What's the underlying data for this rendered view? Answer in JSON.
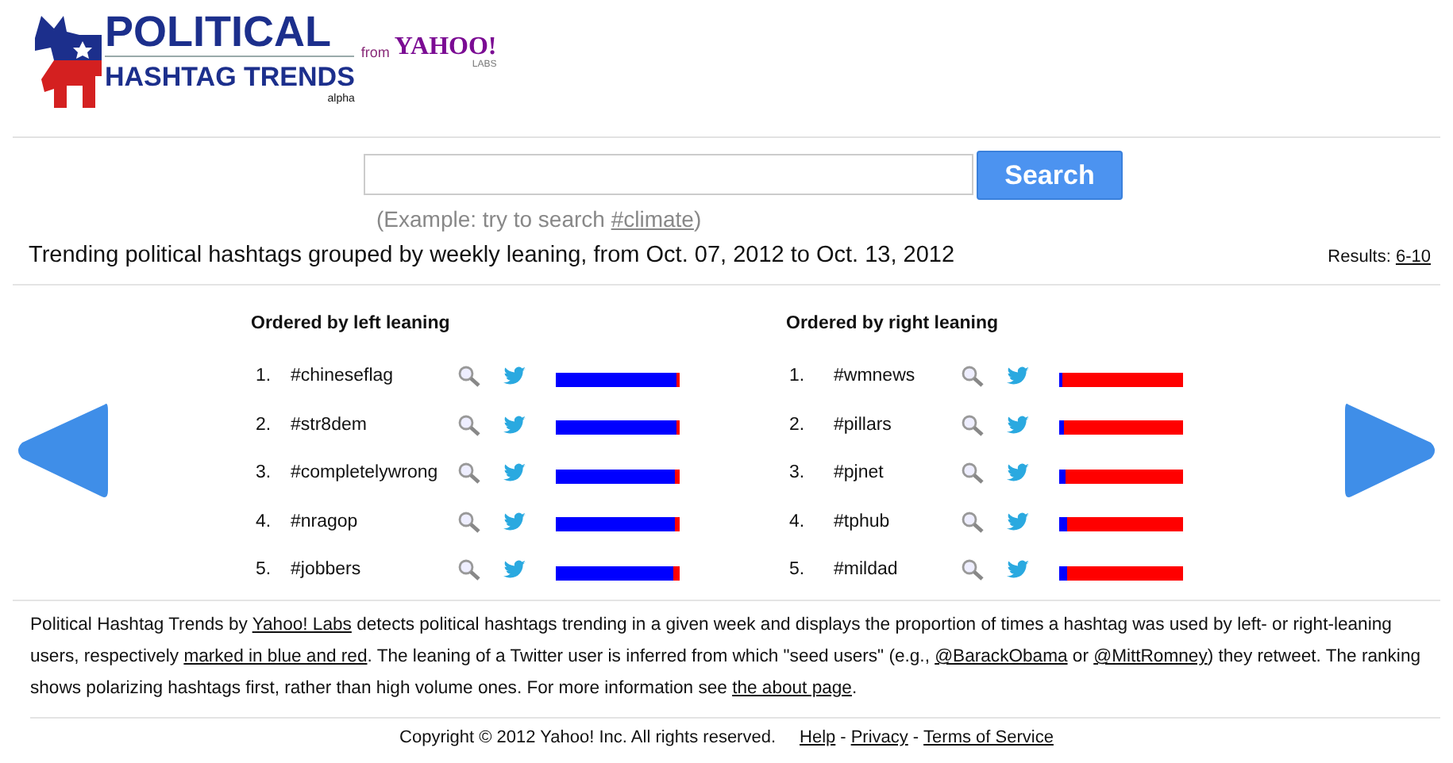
{
  "logo": {
    "line1": "POLITICAL",
    "line2": "HASHTAG TRENDS",
    "tag": "alpha",
    "from": "from",
    "brand": "YAHOO!",
    "sub": "LABS"
  },
  "search": {
    "button": "Search",
    "example_prefix": "(Example: try to search ",
    "example_link": "#climate",
    "example_suffix": ")"
  },
  "summary": {
    "text": "Trending political hashtags grouped by weekly leaning, from Oct. 07, 2012 to Oct. 13, 2012",
    "results_label": "Results: ",
    "results_link": "6-10"
  },
  "lists": [
    {
      "title": "Ordered by left leaning",
      "rows": [
        {
          "rank": "1.",
          "tag": "#chineseflag",
          "level": 0.97
        },
        {
          "rank": "2.",
          "tag": "#str8dem",
          "level": 0.97
        },
        {
          "rank": "3.",
          "tag": "#completelywrong",
          "level": 0.965
        },
        {
          "rank": "4.",
          "tag": "#nragop",
          "level": 0.965
        },
        {
          "rank": "5.",
          "tag": "#jobbers",
          "level": 0.945
        }
      ]
    },
    {
      "title": "Ordered by right leaning",
      "rows": [
        {
          "rank": "1.",
          "tag": "#wmnews",
          "level": 0.02
        },
        {
          "rank": "2.",
          "tag": "#pillars",
          "level": 0.035
        },
        {
          "rank": "3.",
          "tag": "#pjnet",
          "level": 0.05
        },
        {
          "rank": "4.",
          "tag": "#tphub",
          "level": 0.06
        },
        {
          "rank": "5.",
          "tag": "#mildad",
          "level": 0.07
        }
      ]
    }
  ],
  "about": [
    {
      "kind": "text",
      "text": "Political Hashtag Trends by "
    },
    {
      "kind": "link",
      "text": "Yahoo! Labs"
    },
    {
      "kind": "text",
      "text": " detects political hashtags trending in a given week and displays the proportion of times a hashtag was used by left- or right-leaning users, respectively "
    },
    {
      "kind": "link",
      "text": "marked in blue and red"
    },
    {
      "kind": "text",
      "text": ". The leaning of a Twitter user is inferred from which \"seed users\" (e.g., "
    },
    {
      "kind": "link",
      "text": "@BarackObama"
    },
    {
      "kind": "text",
      "text": " or "
    },
    {
      "kind": "link",
      "text": "@MittRomney"
    },
    {
      "kind": "text",
      "text": ") they retweet. The ranking shows polarizing hashtags first, rather than high volume ones. For more information see "
    },
    {
      "kind": "link",
      "text": "the about page"
    },
    {
      "kind": "text",
      "text": "."
    }
  ],
  "footer": {
    "copyright": "Copyright © 2012 Yahoo! Inc. All rights reserved.",
    "links": [
      "Help",
      "Privacy",
      "Terms of Service"
    ],
    "separator": "-"
  }
}
